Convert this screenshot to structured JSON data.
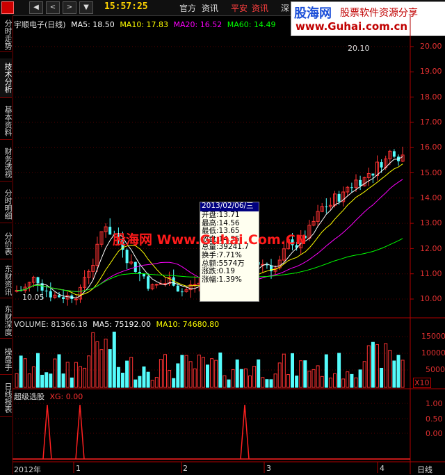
{
  "topbar": {
    "time": "15:57:25",
    "menu": [
      "官方",
      "资讯",
      "平安",
      "资讯",
      "深"
    ],
    "nav_buttons": [
      "◀",
      "<",
      ">",
      "▼"
    ]
  },
  "logo": {
    "name": "股海网",
    "tagline": "股票软件资源分享",
    "url": "www.Guhai.com.cn"
  },
  "sidebar": {
    "items": [
      "分时走势",
      "技术分析",
      "基本资料",
      "财务透视",
      "分时明细",
      "分价表",
      "东财资讯",
      "东财深度",
      "操盘手",
      "日线报表"
    ]
  },
  "main": {
    "stock_title": "宇顺电子(日线)",
    "ma": [
      {
        "label": "MA5: 18.50",
        "color": "#ffffff"
      },
      {
        "label": "MA10: 17.83",
        "color": "#ffff00"
      },
      {
        "label": "MA20: 16.52",
        "color": "#ff00ff"
      },
      {
        "label": "MA60: 14.49",
        "color": "#00ff00"
      }
    ],
    "high_label": "20.10",
    "low_label": "10.05",
    "price_axis": [
      "20.00",
      "19.00",
      "18.00",
      "17.00",
      "16.00",
      "15.00",
      "14.00",
      "13.00",
      "12.00",
      "11.00",
      "10.00"
    ]
  },
  "tooltip": {
    "date": "2013/02/06/三",
    "rows": [
      "开盘:13.71",
      "最高:14.56",
      "最低:13.65",
      "收盘:14.35",
      "总量:39241.7",
      "换手:7.71%",
      "总额:5574万",
      "涨跌:0.19",
      "涨幅:1.39%"
    ]
  },
  "watermark": "股海网 Www.Guhai.Com.CN",
  "volume": {
    "title": "VOLUME: 81366.18",
    "ma5": "MA5: 75192.00",
    "ma10": "MA10: 74680.80",
    "axis": [
      "15000",
      "10000",
      "5000"
    ],
    "unit": "X10"
  },
  "indicator": {
    "title": "超级选股",
    "xg": "XG: 0.00",
    "axis": [
      "1.00",
      "0.50",
      "0.00"
    ]
  },
  "xaxis": {
    "labels": [
      "2012年",
      "1",
      "2",
      "3",
      "4"
    ],
    "period": "日线"
  },
  "colors": {
    "up": "#ff3232",
    "down": "#54fcfc",
    "axis": "#b00000"
  }
}
